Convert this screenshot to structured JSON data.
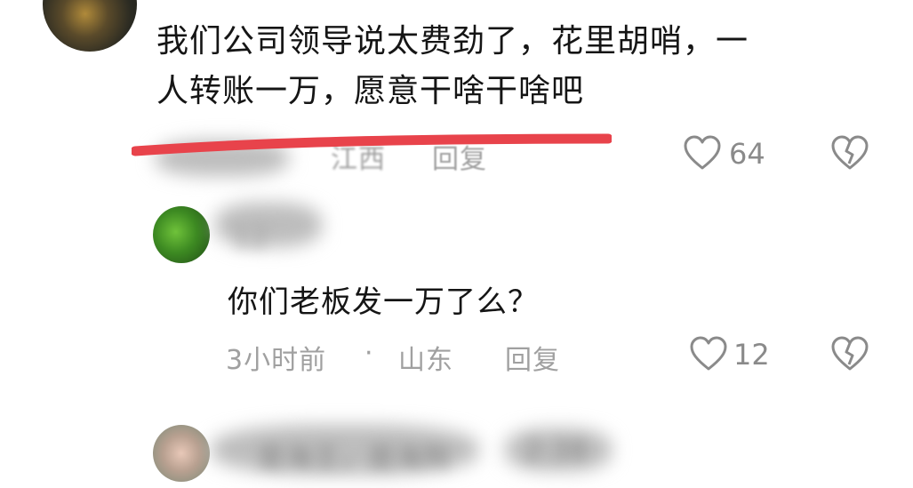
{
  "comment_1": {
    "text_line_1": "我们公司领导说太费劲了，花里胡哨，一",
    "text_line_2": "人转账一万，愿意干啥干啥吧",
    "meta_location": "江西",
    "reply_label": "回复",
    "like_count": "64"
  },
  "comment_2": {
    "author_blurred": "12",
    "text": "你们老板发一万了么？",
    "time": "3小时前",
    "separator": "·",
    "location": "山东",
    "reply_label": "回复",
    "like_count": "12"
  },
  "comment_3": {
    "author_blurred": "是海王，是海狗",
    "time_blurred": "2:38"
  },
  "icons": {
    "like": "heart-outline-icon",
    "dislike": "broken-heart-icon"
  },
  "colors": {
    "highlight_stroke": "#e8434b",
    "icon_gray": "#8a8a8a"
  }
}
